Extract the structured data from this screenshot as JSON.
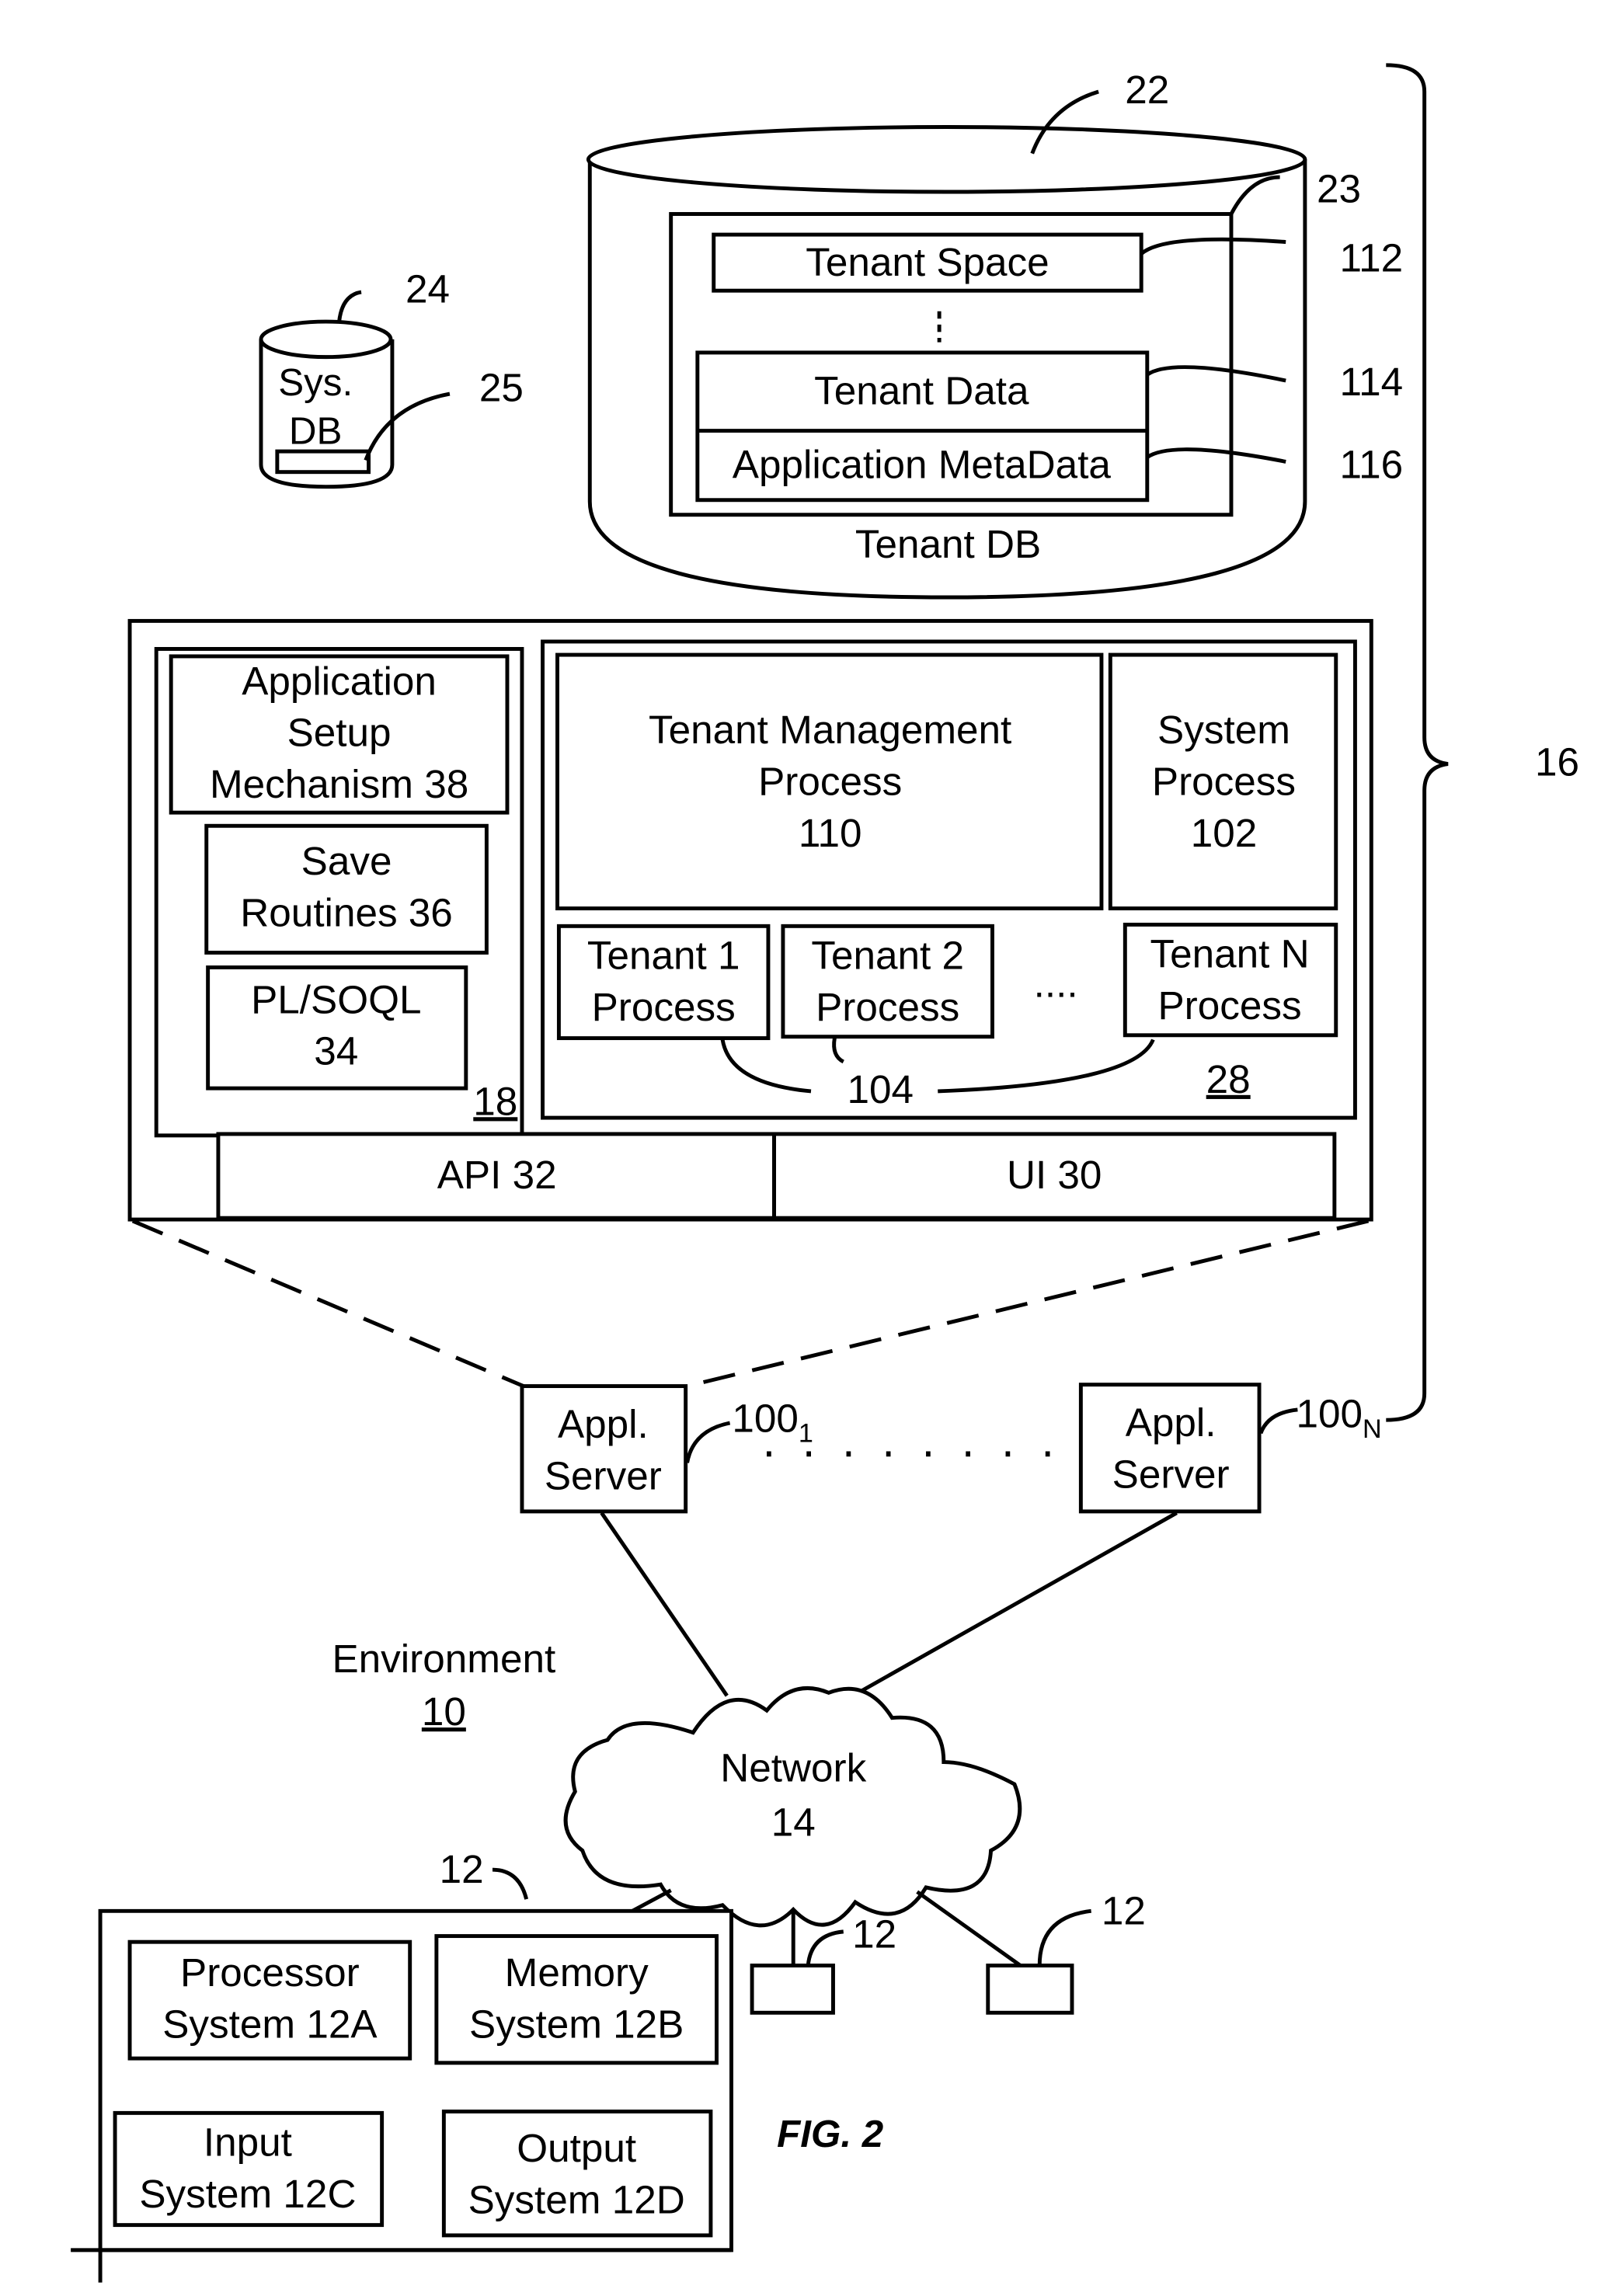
{
  "figure": {
    "caption": "FIG. 2",
    "environment": {
      "label": "Environment",
      "ref": "10"
    },
    "system_bracket_ref": "16"
  },
  "tenant_db": {
    "ref": "22",
    "label": "Tenant DB",
    "inner_ref": "23",
    "tenant_space": {
      "label": "Tenant Space",
      "ref": "112"
    },
    "tenant_data": {
      "label": "Tenant Data",
      "ref": "114"
    },
    "app_metadata": {
      "label": "Application MetaData",
      "ref": "116"
    }
  },
  "sys_db": {
    "ref": "24",
    "line1": "Sys.",
    "line2": "DB",
    "inner_ref": "25"
  },
  "app_server_detail": {
    "left_panel": {
      "ref": "18",
      "setup": {
        "line1": "Application",
        "line2": "Setup",
        "line3": "Mechanism 38"
      },
      "save": {
        "line1": "Save",
        "line2": "Routines 36"
      },
      "plsoql": {
        "line1": "PL/SOQL",
        "line2": "34"
      }
    },
    "right_panel": {
      "ref": "28",
      "tenant_mgmt": {
        "line1": "Tenant Management",
        "line2": "Process",
        "line3": "110"
      },
      "system_process": {
        "line1": "System",
        "line2": "Process",
        "line3": "102"
      },
      "tenant1": {
        "line1": "Tenant 1",
        "line2": "Process"
      },
      "tenant2": {
        "line1": "Tenant 2",
        "line2": "Process"
      },
      "tenantN": {
        "line1": "Tenant N",
        "line2": "Process"
      },
      "ellipsis": "....",
      "process_ref": "104"
    },
    "api": "API 32",
    "ui": "UI 30"
  },
  "servers": [
    {
      "line1": "Appl.",
      "line2": "Server",
      "ref": "100",
      "ref_sub": "1"
    },
    {
      "line1": "Appl.",
      "line2": "Server",
      "ref": "100",
      "ref_sub": "N"
    }
  ],
  "network": {
    "line1": "Network",
    "line2": "14"
  },
  "user_system": {
    "ref": "12",
    "processor": {
      "line1": "Processor",
      "line2": "System 12A"
    },
    "memory": {
      "line1": "Memory",
      "line2": "System 12B"
    },
    "input": {
      "line1": "Input",
      "line2": "System 12C"
    },
    "output": {
      "line1": "Output",
      "line2": "System 12D"
    }
  },
  "other_users": [
    {
      "ref": "12"
    },
    {
      "ref": "12"
    }
  ]
}
